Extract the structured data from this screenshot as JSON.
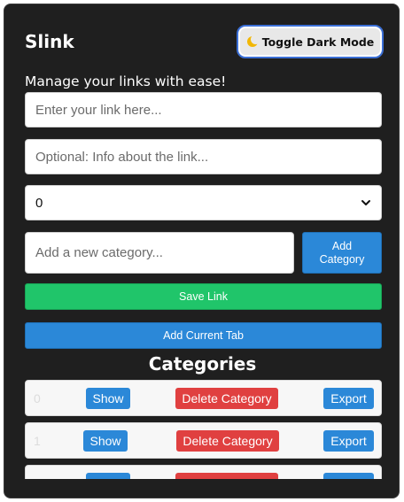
{
  "app": {
    "title": "Slink",
    "toggle_label": "Toggle Dark Mode",
    "subtitle": "Manage your links with ease!"
  },
  "form": {
    "link_placeholder": "Enter your link here...",
    "info_placeholder": "Optional: Info about the link...",
    "category_select_value": "0",
    "new_category_placeholder": "Add a new category...",
    "add_category_label": "Add Category",
    "save_link_label": "Save Link",
    "add_current_tab_label": "Add Current Tab"
  },
  "categories": {
    "heading": "Categories",
    "show_label": "Show",
    "delete_label": "Delete Category",
    "export_label": "Export",
    "items": [
      {
        "name": "0"
      },
      {
        "name": "1"
      },
      {
        "name": ""
      }
    ]
  },
  "colors": {
    "panel_bg": "#1f1f1f",
    "primary": "#2b88d8",
    "success": "#20c56a",
    "danger": "#e04040"
  },
  "icons": {
    "toggle": "moon-icon",
    "select": "chevron-down-icon"
  }
}
